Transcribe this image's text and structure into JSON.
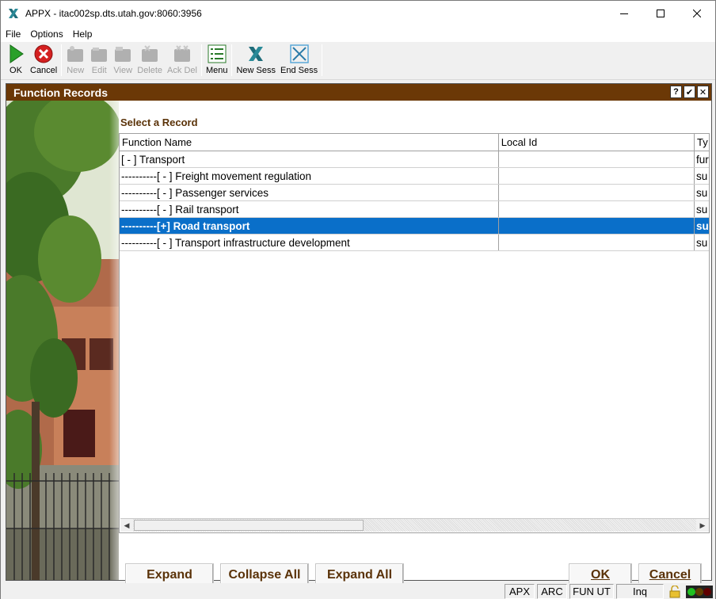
{
  "window": {
    "title": "APPX - itac002sp.dts.utah.gov:8060:3956"
  },
  "menu": [
    "File",
    "Options",
    "Help"
  ],
  "toolbar": {
    "ok": "OK",
    "cancel": "Cancel",
    "new": "New",
    "edit": "Edit",
    "view": "View",
    "delete": "Delete",
    "ack_del": "Ack Del",
    "menu": "Menu",
    "new_sess": "New Sess",
    "end_sess": "End Sess"
  },
  "frame": {
    "title": "Function Records",
    "help": "?",
    "check": "✔",
    "close": "✕"
  },
  "section_label": "Select a Record",
  "grid": {
    "columns": [
      "Function Name",
      "Local Id",
      "Ty"
    ],
    "rows": [
      {
        "name": "[ - ] Transport",
        "local_id": "",
        "type": "fur",
        "selected": false
      },
      {
        "name": "----------[ - ] Freight movement regulation",
        "local_id": "",
        "type": "su",
        "selected": false
      },
      {
        "name": "----------[ - ] Passenger services",
        "local_id": "",
        "type": "su",
        "selected": false
      },
      {
        "name": "----------[ - ] Rail transport",
        "local_id": "",
        "type": "su",
        "selected": false
      },
      {
        "name": "----------[+] Road transport",
        "local_id": "",
        "type": "su",
        "selected": true
      },
      {
        "name": "----------[ - ] Transport infrastructure development",
        "local_id": "",
        "type": "su",
        "selected": false
      }
    ]
  },
  "buttons": {
    "expand": "Expand",
    "collapse_all": "Collapse All",
    "expand_all": "Expand All",
    "ok": "OK",
    "cancel": "Cancel"
  },
  "statusbar": {
    "apx": "APX",
    "arc": "ARC",
    "fun": "FUN UT",
    "mode": "Inq"
  },
  "colors": {
    "frame_title_bg": "#6b3806",
    "selection": "#0a6fc9",
    "label_text": "#5a3208"
  }
}
